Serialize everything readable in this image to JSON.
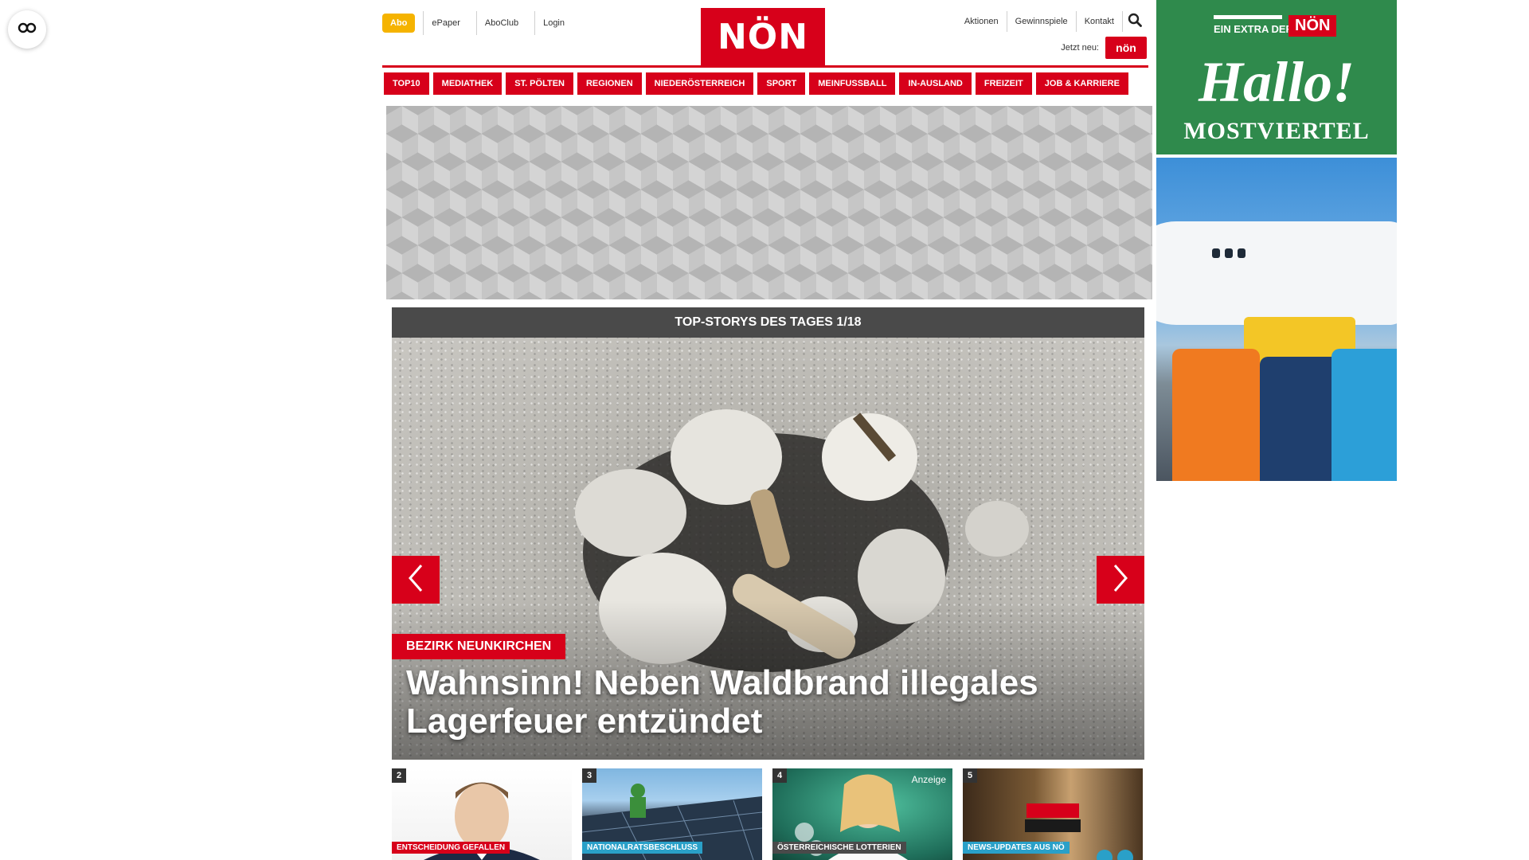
{
  "header": {
    "abo_label": "Abo",
    "left_links": [
      "ePaper",
      "AboClub",
      "Login"
    ],
    "logo_text": "NÖN",
    "right_links": [
      "Aktionen",
      "Gewinnspiele",
      "Kontakt"
    ],
    "jetzt_neu_label": "Jetzt neu:",
    "mini_logo_text": "nön"
  },
  "main_nav": [
    "TOP10",
    "MEDIATHEK",
    "ST. PÖLTEN",
    "REGIONEN",
    "NIEDERÖSTERREICH",
    "SPORT",
    "MEINFUSSBALL",
    "IN-AUSLAND",
    "FREIZEIT",
    "JOB & KARRIERE"
  ],
  "top_stories": {
    "header": "TOP-STORYS DES TAGES 1/18",
    "current": {
      "tag": "BEZIRK NEUNKIRCHEN",
      "title": "Wahnsinn! Neben Waldbrand illegales Lagerfeuer entzündet"
    },
    "thumbnails": [
      {
        "num": "2",
        "tag": "ENTSCHEIDUNG GEFALLEN",
        "tag_color": "#d7001a",
        "badge": ""
      },
      {
        "num": "3",
        "tag": "NATIONALRATSBESCHLUSS",
        "tag_color": "#2aa0c8",
        "badge": ""
      },
      {
        "num": "4",
        "tag": "ÖSTERREICHISCHE LOTTERIEN",
        "tag_color": "#4a4a4a",
        "badge": "Anzeige"
      },
      {
        "num": "5",
        "tag": "NEWS-UPDATES AUS NÖ",
        "tag_color": "#2aa0c8",
        "badge": ""
      }
    ]
  },
  "sidebar_ad": {
    "extra_label": "EIN EXTRA DER",
    "noen_label": "NÖN",
    "hallo": "Hallo!",
    "region": "MOSTVIERTEL"
  },
  "colors": {
    "brand_red": "#d7001a",
    "abo_yellow": "#f5b300",
    "dark_gray": "#4a4a4a",
    "ad_green": "#2f8a4c"
  },
  "icons": [
    "accessibility-icon",
    "search-icon",
    "chevron-left-icon",
    "chevron-right-icon"
  ]
}
